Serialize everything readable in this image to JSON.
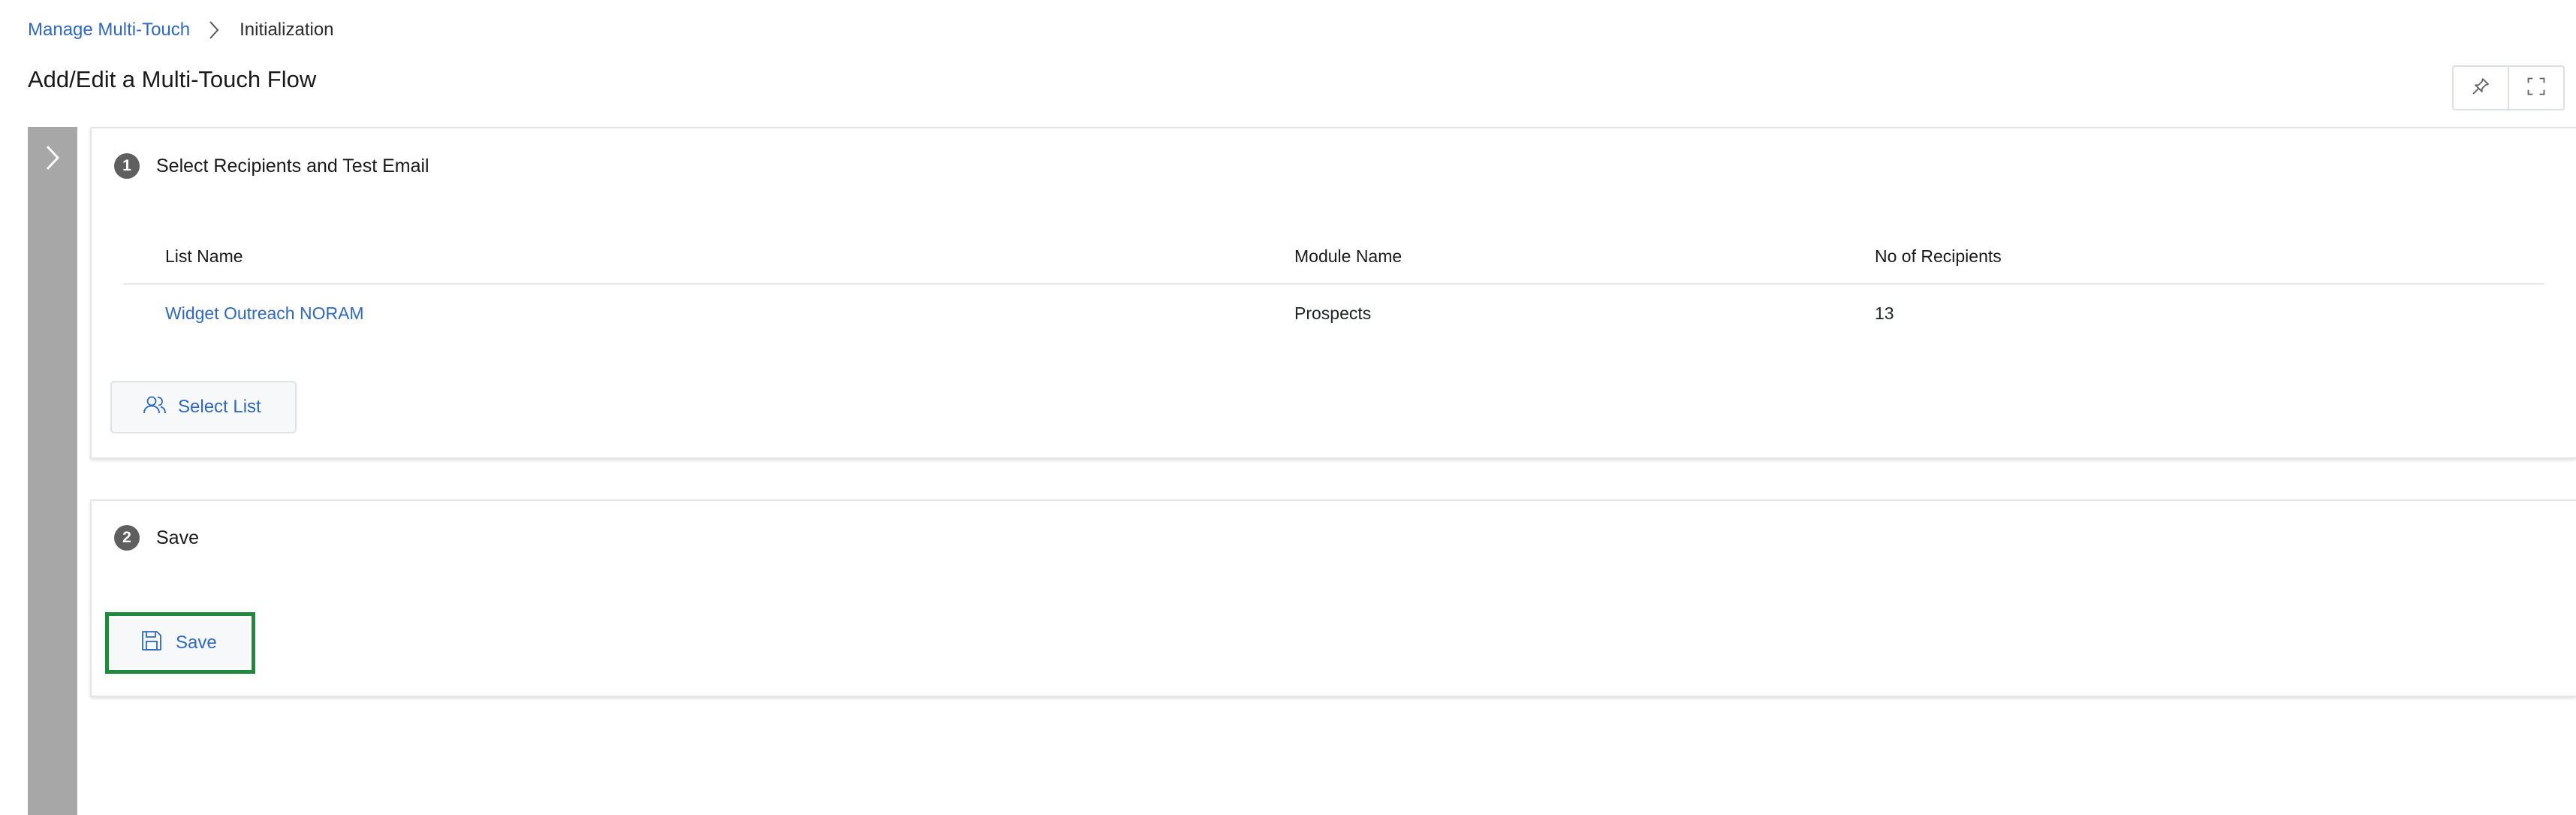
{
  "breadcrumb": {
    "parent": "Manage Multi-Touch",
    "current": "Initialization"
  },
  "page": {
    "title": "Add/Edit a Multi-Touch Flow"
  },
  "toolbar": {
    "pin_icon": "pin-icon",
    "fullscreen_icon": "fullscreen-icon"
  },
  "steps": [
    {
      "number": "1",
      "title": "Select Recipients and Test Email",
      "table": {
        "columns": [
          "List Name",
          "Module Name",
          "No of Recipients"
        ],
        "rows": [
          {
            "list_name": "Widget Outreach NORAM",
            "module_name": "Prospects",
            "recipients": "13"
          }
        ]
      },
      "button_label": "Select List"
    },
    {
      "number": "2",
      "title": "Save",
      "button_label": "Save"
    }
  ],
  "colors": {
    "link": "#2f68c2",
    "rail": "#a7a7a7",
    "highlight": "#1f8a3c",
    "step_badge": "#5f5f5f"
  }
}
